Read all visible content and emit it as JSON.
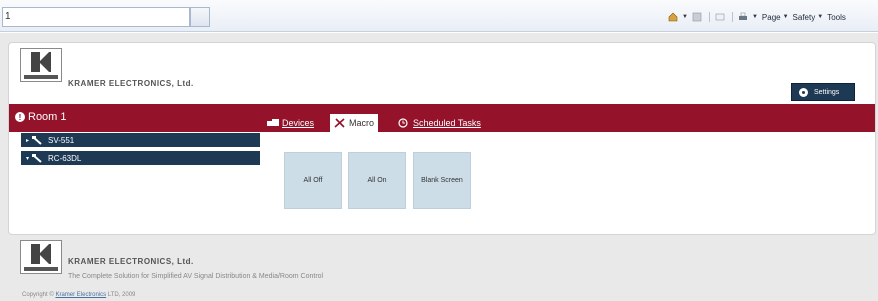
{
  "browser": {
    "tab_title": "1",
    "commands": [
      "Page",
      "Safety",
      "Tools"
    ]
  },
  "header": {
    "company": "KRAMER ELECTRONICS, Ltd.",
    "settings_label": "Settings"
  },
  "room": {
    "title": "Room 1"
  },
  "tabs": [
    {
      "label": "Devices",
      "active": false
    },
    {
      "label": "Macro",
      "active": true
    },
    {
      "label": "Scheduled Tasks",
      "active": false
    }
  ],
  "devices": [
    {
      "name": "SV-551",
      "arrow": "▸"
    },
    {
      "name": "RC-63DL",
      "arrow": "▾"
    }
  ],
  "macros": [
    "All Off",
    "All On",
    "Blank Screen"
  ],
  "footer": {
    "company": "KRAMER ELECTRONICS, Ltd.",
    "tagline": "The Complete Solution for Simplified AV Signal Distribution & Media/Room Control",
    "copyright_prefix": "Copyright ©",
    "copyright_link": "Kramer Electronics",
    "copyright_suffix": "LTD, 2009"
  },
  "colors": {
    "room_bar": "#94132b",
    "navy": "#1e3954",
    "macro_tile": "#cddde7"
  }
}
